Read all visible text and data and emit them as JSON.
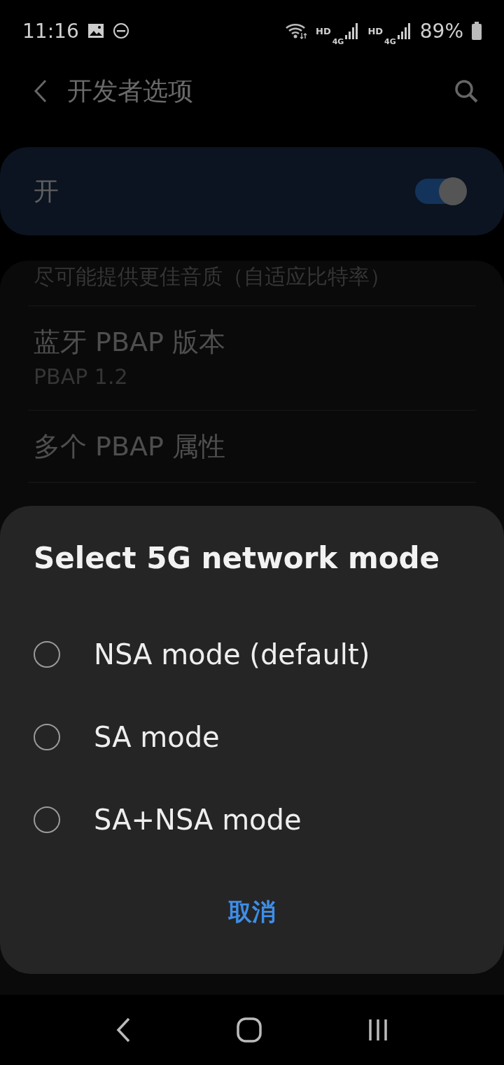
{
  "status_bar": {
    "time": "11:16",
    "sims": [
      {
        "hd": "HD",
        "net": "4G"
      },
      {
        "hd": "HD",
        "net": "4G"
      }
    ],
    "battery": "89%"
  },
  "app_bar": {
    "title": "开发者选项"
  },
  "master_switch": {
    "label": "开",
    "on": true
  },
  "settings": [
    {
      "subtitle": "尽可能提供更佳音质（自适应比特率）"
    },
    {
      "title": "蓝牙 PBAP 版本",
      "subtitle": "PBAP 1.2"
    },
    {
      "title": "多个 PBAP 属性"
    }
  ],
  "dialog": {
    "title": "Select 5G network mode",
    "options": [
      {
        "label": "NSA mode (default)",
        "selected": false
      },
      {
        "label": "SA mode",
        "selected": false
      },
      {
        "label": "SA+NSA mode",
        "selected": false
      }
    ],
    "cancel": "取消"
  }
}
